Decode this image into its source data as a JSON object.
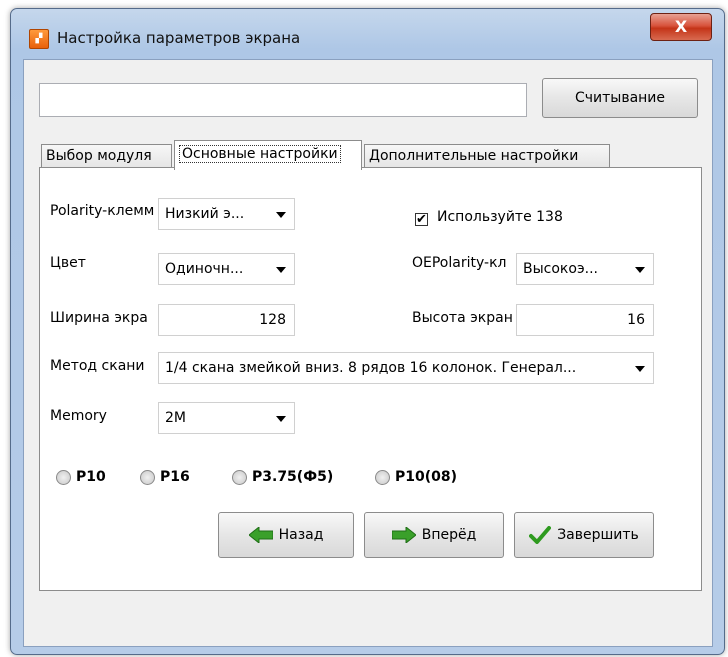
{
  "window": {
    "title": "Настройка параметров экрана",
    "close_label": "X"
  },
  "toolbar": {
    "path_value": "",
    "read_button": "Считывание"
  },
  "tabs": [
    {
      "label": "Выбор модуля"
    },
    {
      "label": "Основные настройки"
    },
    {
      "label": "Дополнительные настройки"
    }
  ],
  "form": {
    "polarity_label": "Polarity-клемм",
    "polarity_value": "Низкий э...",
    "use138_label": "Используйте 138",
    "use138_checked": "✔",
    "color_label": "Цвет",
    "color_value": "Одиночн...",
    "oepolarity_label": "OEPolarity-кл",
    "oepolarity_value": "Высокоэ...",
    "width_label": "Ширина экра",
    "width_value": "128",
    "height_label": "Высота экран",
    "height_value": "16",
    "scan_label": "Метод скани",
    "scan_value": "1/4 скана змейкой вниз. 8 рядов 16 колонок. Генерал...",
    "memory_label": "Memory",
    "memory_value": "2M"
  },
  "radios": [
    {
      "label": "P10"
    },
    {
      "label": "P16"
    },
    {
      "label": "P3.75(Ф5)"
    },
    {
      "label": "P10(08)"
    }
  ],
  "buttons": {
    "back": "Назад",
    "next": "Вперёд",
    "finish": "Завершить"
  },
  "colors": {
    "arrow_green": "#3aa02a",
    "check_green": "#2e9a1f"
  }
}
